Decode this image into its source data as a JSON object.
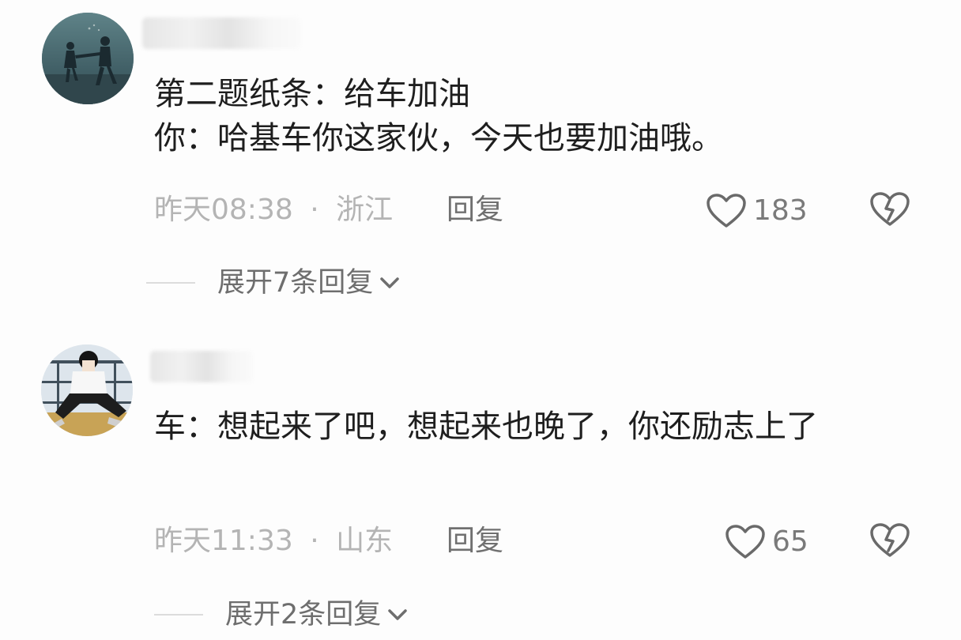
{
  "comments": [
    {
      "text": "第二题纸条：给车加油\n你：哈基车你这家伙，今天也要加油哦。",
      "time": "昨天08:38",
      "location": "浙江",
      "meta_sep": "·",
      "reply_label": "回复",
      "likes": "183",
      "expand_label": "展开7条回复"
    },
    {
      "text": "车：想起来了吧，想起来也晚了，你还励志上了",
      "time": "昨天11:33",
      "location": "山东",
      "meta_sep": "·",
      "reply_label": "回复",
      "likes": "65",
      "expand_label": "展开2条回复"
    }
  ],
  "icons": {
    "like": "heart-outline-icon",
    "dislike": "broken-heart-icon",
    "expand": "chevron-down-icon"
  },
  "colors": {
    "meta": "#b4b4b4",
    "reply": "#707070",
    "text": "#1e1e1e"
  }
}
